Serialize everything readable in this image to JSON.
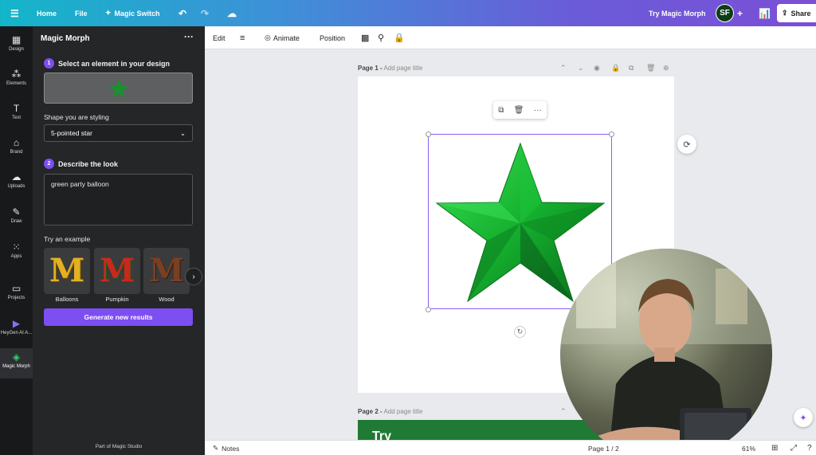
{
  "topbar": {
    "menu_icon": "hamburger-icon",
    "home": "Home",
    "file": "File",
    "magic_switch": "Magic Switch",
    "try_magic_morph": "Try Magic Morph",
    "avatar_initials": "SF",
    "share": "Share"
  },
  "rail": {
    "items": [
      {
        "label": "Design",
        "icon": "design-icon"
      },
      {
        "label": "Elements",
        "icon": "elements-icon"
      },
      {
        "label": "Text",
        "icon": "text-icon"
      },
      {
        "label": "Brand",
        "icon": "brand-icon"
      },
      {
        "label": "Uploads",
        "icon": "uploads-icon"
      },
      {
        "label": "Draw",
        "icon": "draw-icon"
      },
      {
        "label": "Apps",
        "icon": "apps-icon"
      },
      {
        "label": "Projects",
        "icon": "projects-icon"
      },
      {
        "label": "HeyGen AI A...",
        "icon": "heygen-icon"
      },
      {
        "label": "Magic Morph",
        "icon": "magic-morph-icon"
      }
    ]
  },
  "panel": {
    "title": "Magic Morph",
    "step1_num": "1",
    "step1_label": "Select an element in your design",
    "shape_label": "Shape you are styling",
    "shape_value": "5-pointed star",
    "step2_num": "2",
    "step2_label": "Describe the look",
    "prompt_value": "green party balloon",
    "examples_label": "Try an example",
    "examples": [
      {
        "label": "Balloons",
        "letter": "M"
      },
      {
        "label": "Pumpkin",
        "letter": "M"
      },
      {
        "label": "Wood",
        "letter": "M"
      }
    ],
    "generate": "Generate new results",
    "footer": "Part of Magic Studio"
  },
  "toolbar2": {
    "edit": "Edit",
    "animate": "Animate",
    "position": "Position"
  },
  "canvas": {
    "page1_prefix": "Page 1 -",
    "page1_placeholder": "Add page title",
    "page2_prefix": "Page 2 -",
    "page2_placeholder": "Add page title",
    "page2_text": "Try"
  },
  "bottombar": {
    "notes": "Notes",
    "page_counter": "Page 1 / 2",
    "zoom": "61%"
  },
  "colors": {
    "accent": "#7d4ef2",
    "star": "#16a830",
    "panel_bg": "#252627"
  }
}
